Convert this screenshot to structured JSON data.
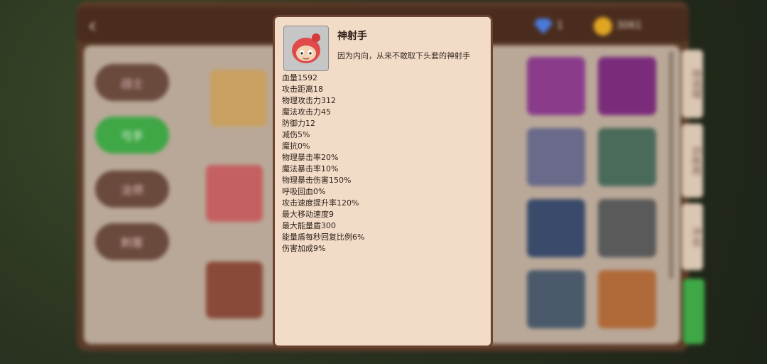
{
  "header": {
    "back_label": "‹",
    "gem_icon": "gem-icon",
    "gem_count": "1",
    "coin_icon": "coin-icon",
    "coin_count": "3061"
  },
  "classes": [
    {
      "label": "战士",
      "active": false
    },
    {
      "label": "弓手",
      "active": true
    },
    {
      "label": "法师",
      "active": false
    },
    {
      "label": "刺客",
      "active": false
    }
  ],
  "side_tabs": [
    "待选域",
    "训练用",
    "冲击"
  ],
  "popup": {
    "name": "神射手",
    "description": "因为内向，从来不敢取下头套的神射手",
    "avatar_icon": "archer-hero-avatar",
    "stats": [
      "血量1592",
      "攻击距离18",
      "物理攻击力312",
      "魔法攻击力45",
      "防御力12",
      "减伤5%",
      "魔抗0%",
      "物理暴击率20%",
      "魔法暴击率10%",
      "物理暴击伤害150%",
      "呼吸回血0%",
      "攻击速度提升率120%",
      "最大移动速度9",
      "最大能量盾300",
      "能量盾每秒回复比例6%",
      "伤害加成9%"
    ]
  },
  "colors": {
    "popup_bg": "#f2dcc8",
    "popup_border": "#6b4330",
    "active_class": "#3fa745"
  }
}
